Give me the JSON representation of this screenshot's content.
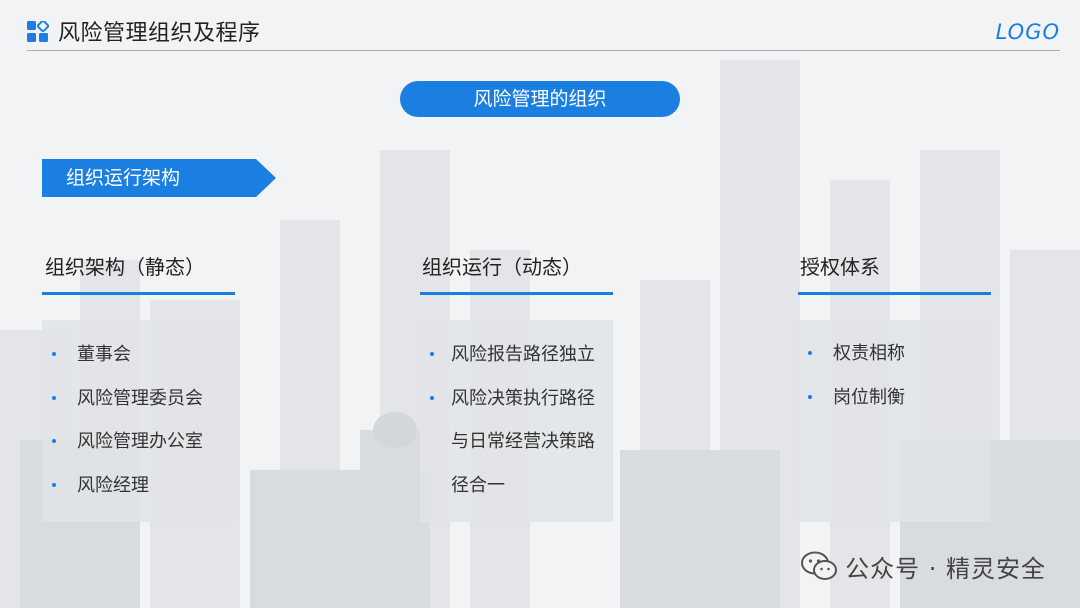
{
  "header": {
    "title": "风险管理组织及程序",
    "logo": "LOGO"
  },
  "section_pill": "风险管理的组织",
  "arrow_tag": "组织运行架构",
  "columns": [
    {
      "heading": "组织架构（静态）",
      "items": [
        "董事会",
        "风险管理委员会",
        "风险管理办公室",
        "风险经理"
      ]
    },
    {
      "heading": "组织运行（动态）",
      "items": [
        "风险报告路径独立",
        "风险决策执行路径与日常经营决策路径合一"
      ]
    },
    {
      "heading": "授权体系",
      "items": [
        "权责相称",
        "岗位制衡"
      ]
    }
  ],
  "watermark": "公众号 · 精灵安全",
  "colors": {
    "accent": "#1a7fe0",
    "panel": "#e2e4e7"
  },
  "icons": [
    "grid-logo-icon",
    "wechat-icon"
  ]
}
